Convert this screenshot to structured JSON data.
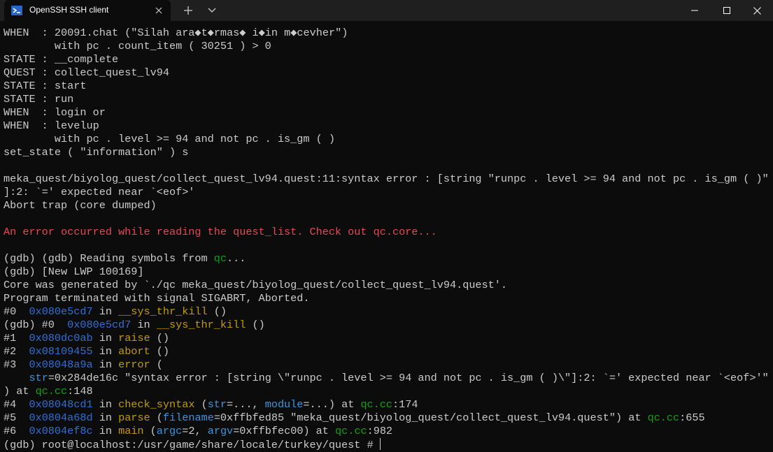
{
  "window": {
    "tab_title": "OpenSSH SSH client",
    "icons": {
      "tab_icon": "terminal-icon",
      "tab_close": "close-icon",
      "new_tab": "plus-icon",
      "dropdown": "chevron-down-icon",
      "minimize": "minimize-icon",
      "maximize": "maximize-icon",
      "close": "close-icon"
    }
  },
  "colors": {
    "background": "#0c0c0c",
    "titlebar": "#1f1f1f",
    "text": "#cccccc",
    "red": "#e74856",
    "green": "#13a10e",
    "blue": "#2f6fd7",
    "yellow": "#c19c00",
    "cyan": "#3a96dd"
  },
  "terminal": {
    "lines": [
      [
        {
          "t": "WHEN  : 20091.chat (\"Silah ara◆t◆rmas◆ i◆in m◆cevher\")"
        }
      ],
      [
        {
          "t": "        with pc . count_item ( 30251 ) > 0"
        }
      ],
      [
        {
          "t": "STATE : __complete"
        }
      ],
      [
        {
          "t": "QUEST : collect_quest_lv94"
        }
      ],
      [
        {
          "t": "STATE : start"
        }
      ],
      [
        {
          "t": "STATE : run"
        }
      ],
      [
        {
          "t": "WHEN  : login or"
        }
      ],
      [
        {
          "t": "WHEN  : levelup"
        }
      ],
      [
        {
          "t": "        with pc . level >= 94 and not pc . is_gm ( )"
        }
      ],
      [
        {
          "t": "set_state ( \"information\" ) s"
        }
      ],
      [
        {
          "t": ""
        }
      ],
      [
        {
          "t": "meka_quest/biyolog_quest/collect_quest_lv94.quest:11:syntax error : [string \"runpc . level >= 94 and not pc . is_gm ( )\""
        }
      ],
      [
        {
          "t": "]:2: `=' expected near `<eof>'"
        }
      ],
      [
        {
          "t": "Abort trap (core dumped)"
        }
      ],
      [
        {
          "t": ""
        }
      ],
      [
        {
          "t": "An error occurred while reading the quest_list. Check out qc.core...",
          "c": "red"
        }
      ],
      [
        {
          "t": ""
        }
      ],
      [
        {
          "t": "(gdb) (gdb) Reading symbols from "
        },
        {
          "t": "qc",
          "c": "green"
        },
        {
          "t": "..."
        }
      ],
      [
        {
          "t": "(gdb) [New LWP 100169]"
        }
      ],
      [
        {
          "t": "Core was generated by `./qc meka_quest/biyolog_quest/collect_quest_lv94.quest'."
        }
      ],
      [
        {
          "t": "Program terminated with signal SIGABRT, Aborted."
        }
      ],
      [
        {
          "t": "#0  "
        },
        {
          "t": "0x080e5cd7",
          "c": "blue"
        },
        {
          "t": " in "
        },
        {
          "t": "__sys_thr_kill",
          "c": "yellow"
        },
        {
          "t": " ()"
        }
      ],
      [
        {
          "t": "(gdb) #0  "
        },
        {
          "t": "0x080e5cd7",
          "c": "blue"
        },
        {
          "t": " in "
        },
        {
          "t": "__sys_thr_kill",
          "c": "yellow"
        },
        {
          "t": " ()"
        }
      ],
      [
        {
          "t": "#1  "
        },
        {
          "t": "0x080dc0ab",
          "c": "blue"
        },
        {
          "t": " in "
        },
        {
          "t": "raise",
          "c": "yellow"
        },
        {
          "t": " ()"
        }
      ],
      [
        {
          "t": "#2  "
        },
        {
          "t": "0x08109455",
          "c": "blue"
        },
        {
          "t": " in "
        },
        {
          "t": "abort",
          "c": "yellow"
        },
        {
          "t": " ()"
        }
      ],
      [
        {
          "t": "#3  "
        },
        {
          "t": "0x08048a9a",
          "c": "blue"
        },
        {
          "t": " in "
        },
        {
          "t": "error",
          "c": "yellow"
        },
        {
          "t": " ("
        }
      ],
      [
        {
          "t": "    "
        },
        {
          "t": "str",
          "c": "cyan"
        },
        {
          "t": "=0x284de16c \"syntax error : [string \\\"runpc . level >= 94 and not pc . is_gm ( )\\\"]:2: `=' expected near `<eof>'\""
        }
      ],
      [
        {
          "t": ") at "
        },
        {
          "t": "qc.cc",
          "c": "green"
        },
        {
          "t": ":148"
        }
      ],
      [
        {
          "t": "#4  "
        },
        {
          "t": "0x08048cd1",
          "c": "blue"
        },
        {
          "t": " in "
        },
        {
          "t": "check_syntax",
          "c": "yellow"
        },
        {
          "t": " ("
        },
        {
          "t": "str",
          "c": "cyan"
        },
        {
          "t": "=..., "
        },
        {
          "t": "module",
          "c": "cyan"
        },
        {
          "t": "=...) at "
        },
        {
          "t": "qc.cc",
          "c": "green"
        },
        {
          "t": ":174"
        }
      ],
      [
        {
          "t": "#5  "
        },
        {
          "t": "0x0804a68d",
          "c": "blue"
        },
        {
          "t": " in "
        },
        {
          "t": "parse",
          "c": "yellow"
        },
        {
          "t": " ("
        },
        {
          "t": "filename",
          "c": "cyan"
        },
        {
          "t": "=0xffbfed85 \"meka_quest/biyolog_quest/collect_quest_lv94.quest\") at "
        },
        {
          "t": "qc.cc",
          "c": "green"
        },
        {
          "t": ":655"
        }
      ],
      [
        {
          "t": "#6  "
        },
        {
          "t": "0x0804ef8c",
          "c": "blue"
        },
        {
          "t": " in "
        },
        {
          "t": "main",
          "c": "yellow"
        },
        {
          "t": " ("
        },
        {
          "t": "argc",
          "c": "cyan"
        },
        {
          "t": "=2, "
        },
        {
          "t": "argv",
          "c": "cyan"
        },
        {
          "t": "=0xffbfec00) at "
        },
        {
          "t": "qc.cc",
          "c": "green"
        },
        {
          "t": ":982"
        }
      ],
      [
        {
          "t": "(gdb) root@localhost:/usr/game/share/locale/turkey/quest # "
        }
      ]
    ]
  }
}
